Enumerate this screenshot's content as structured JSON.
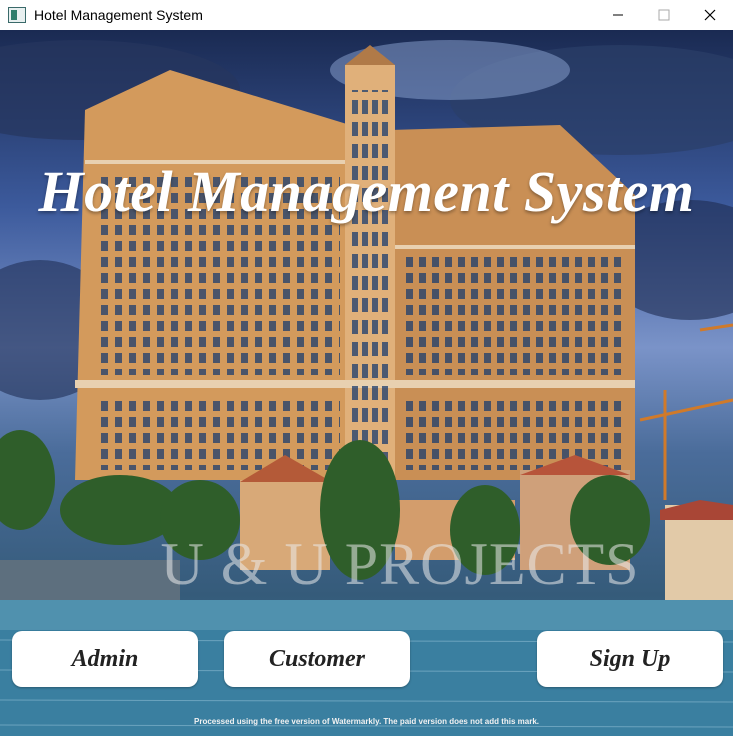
{
  "window": {
    "title": "Hotel Management System",
    "icons": [
      "app-icon",
      "minimize-icon",
      "maximize-icon",
      "close-icon"
    ]
  },
  "main": {
    "headline": "Hotel Management System",
    "watermark_text": "U & U PROJECTS",
    "buttons": {
      "admin": "Admin",
      "customer": "Customer",
      "signup": "Sign Up"
    },
    "footer_note": "Processed using the free version of Watermarkly. The paid version does not add this mark."
  },
  "colors": {
    "titlebar_bg": "#ffffff",
    "button_bg": "#ffffff",
    "headline_color": "#ffffff"
  }
}
